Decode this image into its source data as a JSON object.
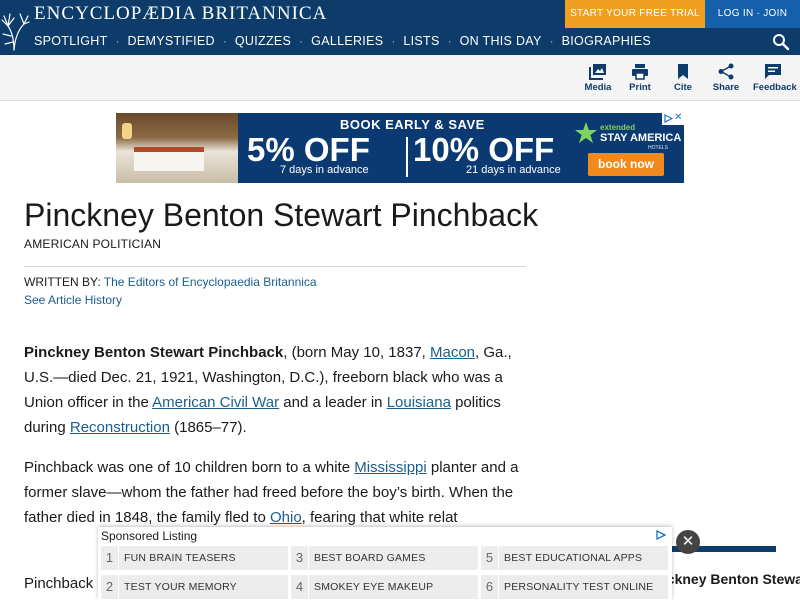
{
  "header": {
    "brand": "ENCYCLOPÆDIA BRITANNICA",
    "trial_button": "START YOUR FREE TRIAL",
    "login_button": "LOG IN · JOIN",
    "nav": [
      "SPOTLIGHT",
      "DEMYSTIFIED",
      "QUIZZES",
      "GALLERIES",
      "LISTS",
      "ON THIS DAY",
      "BIOGRAPHIES"
    ],
    "nav_separator": "·",
    "search_icon": "search-icon"
  },
  "toolbar": {
    "media": "Media",
    "print": "Print",
    "cite": "Cite",
    "share": "Share",
    "feedback": "Feedback"
  },
  "ad": {
    "headline": "BOOK EARLY & SAVE",
    "offer1": "5% OFF",
    "offer1_sub": "7 days in advance",
    "offer2": "10% OFF",
    "offer2_sub": "21 days in advance",
    "brand_small": "extended",
    "brand": "STAY AMERICA",
    "brand_sub": "HOTELS",
    "cta": "book now",
    "ad_close": "✕",
    "colors": {
      "background": "#0b3a73",
      "cta": "#f08a1e",
      "accent": "#7fd35f"
    }
  },
  "article": {
    "title": "Pinckney Benton Stewart Pinchback",
    "subtitle": "AMERICAN POLITICIAN",
    "written_by_label": "WRITTEN BY:",
    "written_by": "The Editors of Encyclopaedia Britannica",
    "history_link": "See Article History",
    "p1": {
      "name": "Pinckney Benton Stewart Pinchback",
      "t1": ", (born May 10, 1837, ",
      "link_macon": "Macon",
      "t2": ", Ga., U.S.—died Dec. 21, 1921, Washington, D.C.), freeborn black who was a Union officer in the ",
      "link_civil_war": "American Civil War",
      "t3": " and a leader in ",
      "link_louisiana": "Louisiana",
      "t4": " politics during ",
      "link_reconstruction": "Reconstruction",
      "t5": " (1865–77)."
    },
    "p2": {
      "t1": "Pinchback was one of 10 children born to a white ",
      "link_mississippi": "Mississippi",
      "t2": " planter and a former slave—whom the father had freed before the boy’s birth. When the father died in 1848, the family fled to ",
      "link_ohio": "Ohio",
      "t3": ", fearing that white relat"
    },
    "p3_start": "Pinchback"
  },
  "side_card": {
    "title": "Pinckney Benton Stewart"
  },
  "sponsored": {
    "title": "Sponsored Listing",
    "close": "✕",
    "items": [
      {
        "num": "1",
        "label": "FUN BRAIN TEASERS"
      },
      {
        "num": "3",
        "label": "BEST BOARD GAMES"
      },
      {
        "num": "5",
        "label": "BEST EDUCATIONAL APPS"
      },
      {
        "num": "2",
        "label": "TEST YOUR MEMORY"
      },
      {
        "num": "4",
        "label": "SMOKEY EYE MAKEUP"
      },
      {
        "num": "6",
        "label": "PERSONALITY TEST ONLINE"
      }
    ]
  },
  "colors": {
    "brand_navy": "#0d3c6b",
    "trial_orange": "#f0a020",
    "login_blue": "#1460aa",
    "link": "#1a5e8f"
  }
}
